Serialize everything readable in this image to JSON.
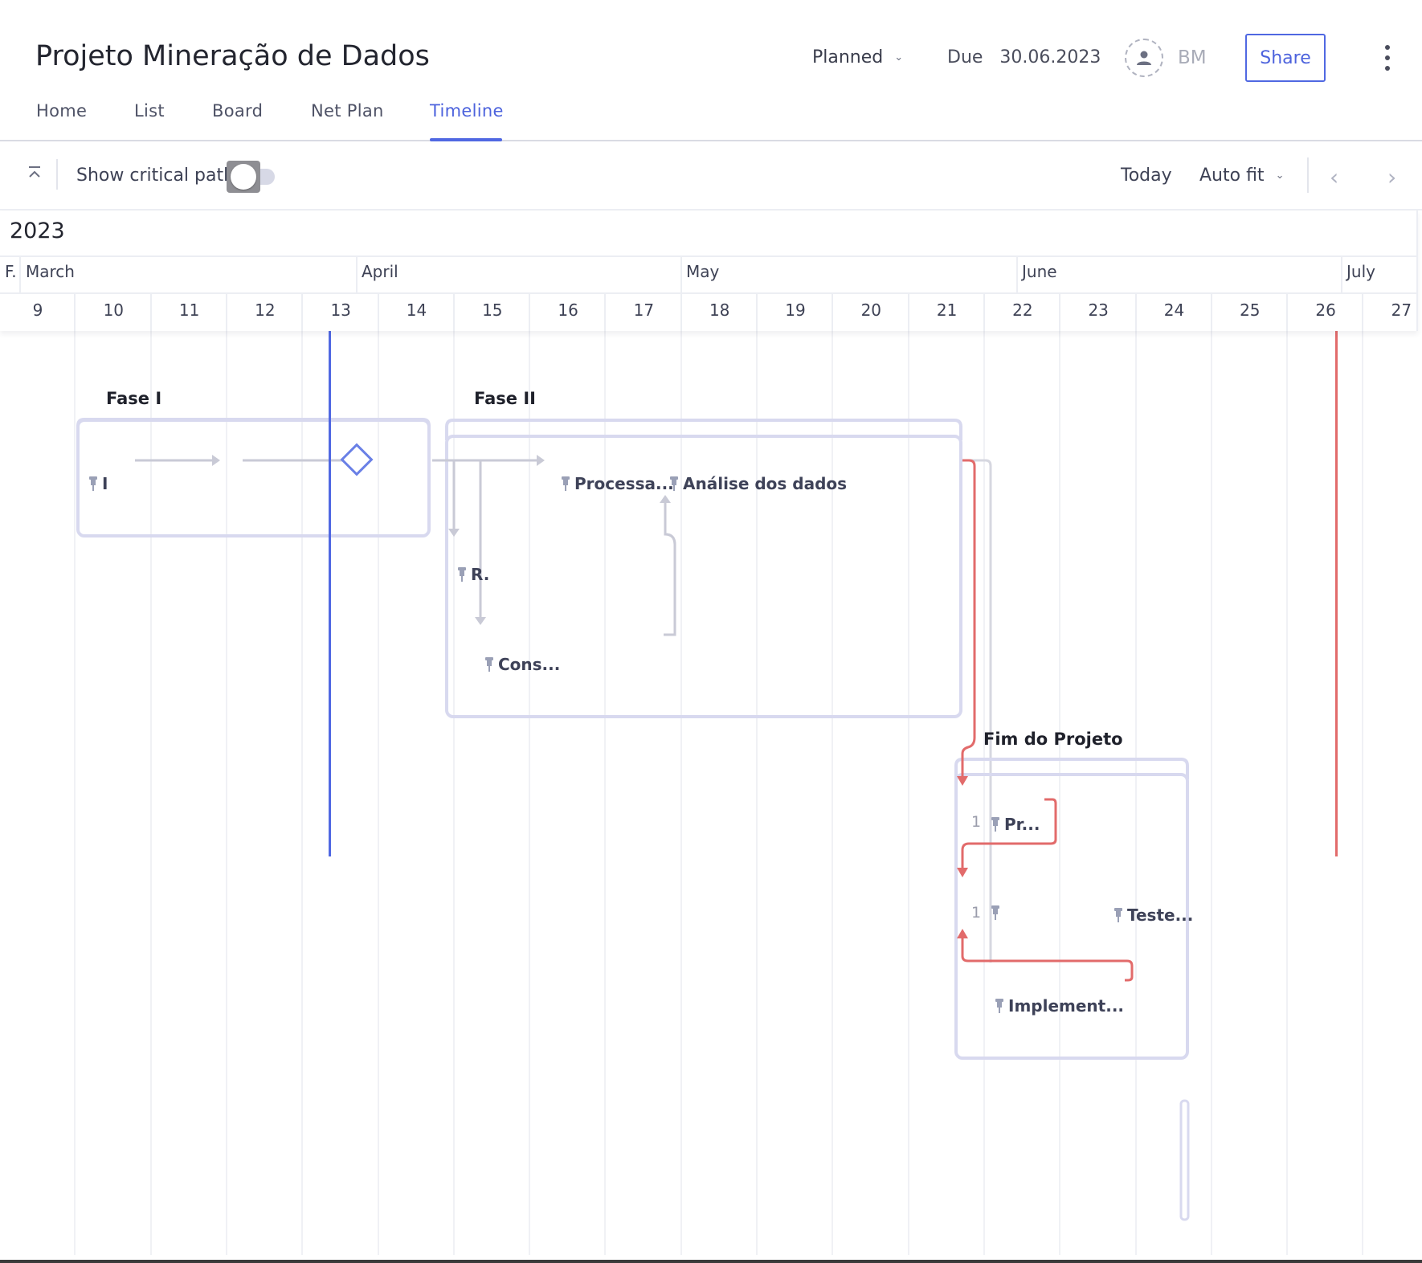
{
  "project": {
    "title": "Projeto Mineração de Dados",
    "status": "Planned",
    "due_label": "Due",
    "due_date": "30.06.2023",
    "assignee_initials": "BM",
    "share_label": "Share"
  },
  "tabs": [
    {
      "label": "Home",
      "active": false
    },
    {
      "label": "List",
      "active": false
    },
    {
      "label": "Board",
      "active": false
    },
    {
      "label": "Net Plan",
      "active": false
    },
    {
      "label": "Timeline",
      "active": true
    }
  ],
  "toolbar": {
    "critical_path_label": "Show critical path",
    "critical_path_on": false,
    "today_label": "Today",
    "zoom_label": "Auto fit"
  },
  "timeline": {
    "year": "2023",
    "months": [
      "F.",
      "March",
      "April",
      "May",
      "June",
      "July"
    ],
    "days": [
      "9",
      "10",
      "11",
      "12",
      "13",
      "14",
      "15",
      "16",
      "17",
      "18",
      "19",
      "20",
      "21",
      "22",
      "23",
      "24",
      "25",
      "26",
      "27"
    ]
  },
  "phases": [
    {
      "label": "Fase I"
    },
    {
      "label": "Fase II"
    },
    {
      "label": "Fim do Projeto"
    }
  ],
  "tasks": {
    "fase1_a": "I",
    "fase2_processa": "Processa...",
    "fase2_analise": "Análise dos dados",
    "fase2_r": "R.",
    "fase2_cons": "Cons...",
    "fim_pr": "Pr...",
    "fim_teste": "Teste...",
    "fim_implement": "Implement...",
    "fim_num1": "1",
    "fim_num2": "1"
  },
  "colors": {
    "accent": "#5068e2",
    "critical": "#e26b6b",
    "phase_border": "#d8d9ef",
    "dependency": "#c9cad6"
  }
}
